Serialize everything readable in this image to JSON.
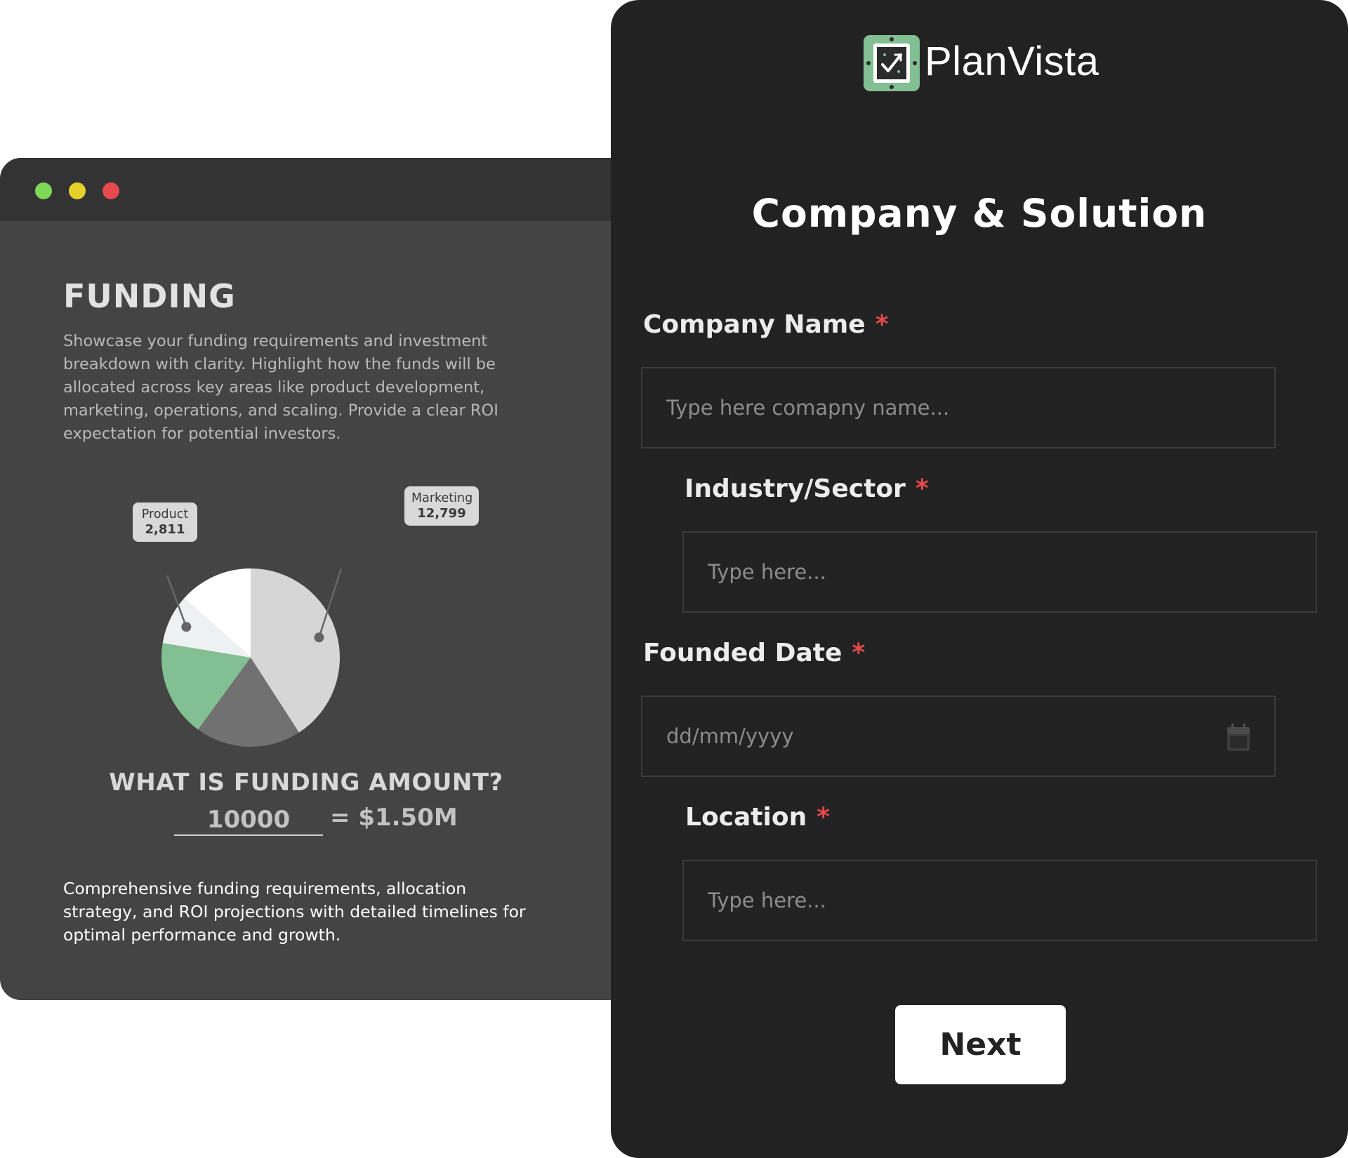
{
  "window_controls": {
    "colors": [
      "#7ed957",
      "#e6d12a",
      "#e5484d"
    ]
  },
  "funding_panel": {
    "title": "FUNDING",
    "description": "Showcase your funding requirements and investment breakdown with clarity. Highlight how the funds will be allocated across key areas like product development, marketing, operations, and scaling. Provide a clear ROI expectation for potential investors.",
    "callouts": [
      {
        "name": "Product",
        "value": "2,811"
      },
      {
        "name": "Marketing",
        "value": "12,799"
      }
    ],
    "question": "WHAT IS FUNDING AMOUNT?",
    "amount_input_value": "10000",
    "amount_result": "= $1.50M",
    "footer_text": "Comprehensive funding requirements, allocation strategy, and ROI projections with detailed timelines for optimal performance and growth."
  },
  "chart_data": {
    "type": "pie",
    "slices": [
      {
        "label": "Marketing",
        "value": 12799,
        "color": "#d6d6d6"
      },
      {
        "value": 6000,
        "color": "#717171"
      },
      {
        "value": 5500,
        "color": "#82bf93"
      },
      {
        "label": "Product",
        "value": 2811,
        "color": "#eef1f2"
      },
      {
        "value": 4200,
        "color": "#ffffff"
      }
    ],
    "start_angle_deg": 0,
    "direction": "clockwise",
    "callout_points": [
      {
        "label": "Product",
        "slice_index": 3
      },
      {
        "label": "Marketing",
        "slice_index": 0
      }
    ]
  },
  "brand": {
    "name": "PlanVista",
    "logo_color": "#82bf93"
  },
  "form": {
    "title": "Company & Solution",
    "required_marker": "*",
    "fields": [
      {
        "label": "Company Name",
        "placeholder": "Type here comapny name..."
      },
      {
        "label": "Industry/Sector",
        "placeholder": "Type here..."
      },
      {
        "label": "Founded Date",
        "placeholder": "dd/mm/yyyy",
        "icon": "calendar-icon"
      },
      {
        "label": "Location",
        "placeholder": "Type here..."
      }
    ],
    "next_label": "Next"
  },
  "colors": {
    "required": "#e5484d",
    "accent": "#82bf93",
    "panel_bg": "#222222",
    "window_bg": "#444444"
  }
}
